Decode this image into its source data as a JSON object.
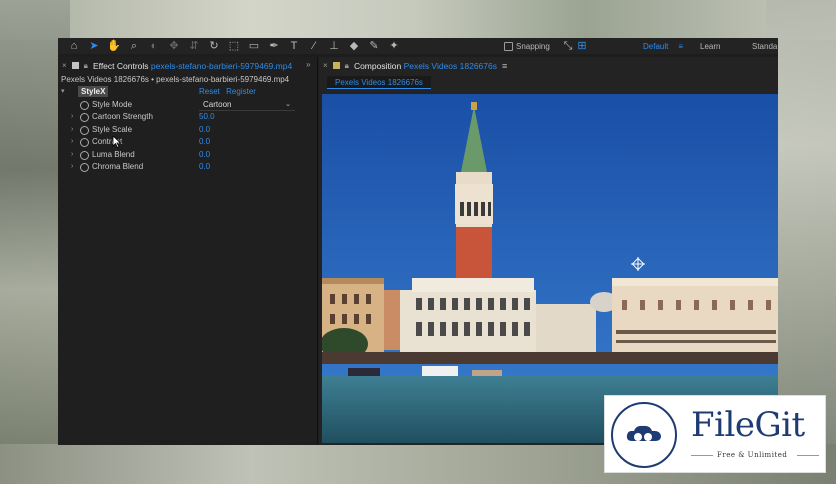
{
  "toolbar": {
    "tools": [
      "home-icon",
      "selection-tool-icon",
      "hand-tool-icon",
      "zoom-tool-icon",
      "orbit-tool-icon",
      "move-tool-icon",
      "dolly-tool-icon",
      "rotate-tool-icon",
      "anchor-tool-icon",
      "rectangle-tool-icon",
      "pen-tool-icon",
      "type-tool-icon",
      "brush-tool-icon",
      "clone-stamp-tool-icon",
      "eraser-tool-icon",
      "roto-brush-tool-icon",
      "puppet-tool-icon"
    ],
    "snapping_label": "Snapping",
    "workspace_default": "Default",
    "workspace_learn": "Learn",
    "workspace_standard": "Standa"
  },
  "effect_controls": {
    "panel_label": "Effect Controls",
    "panel_source": "pexels-stefano-barbieri-5979469.mp4",
    "source_path": "Pexels Videos 1826676s • pexels-stefano-barbieri-5979469.mp4",
    "effect_name": "StyleX",
    "reset_label": "Reset",
    "register_label": "Register",
    "style_mode": {
      "label": "Style Mode",
      "value": "Cartoon"
    },
    "params": [
      {
        "label": "Cartoon Strength",
        "value": "50.0"
      },
      {
        "label": "Style Scale",
        "value": "0.0"
      },
      {
        "label": "Contrast",
        "value": "0.0"
      },
      {
        "label": "Luma Blend",
        "value": "0.0"
      },
      {
        "label": "Chroma Blend",
        "value": "0.0"
      }
    ]
  },
  "composition": {
    "panel_label": "Composition",
    "panel_name": "Pexels Videos 1826676s",
    "tab_label": "Pexels Videos 1826676s"
  },
  "watermark": {
    "title": "FileGit",
    "subtitle": "Free & Unlimited"
  },
  "colors": {
    "accent": "#2d8ceb",
    "panel_bg": "#1f1f1f",
    "sky": "#1e5fb4",
    "brand": "#1e3c73"
  }
}
